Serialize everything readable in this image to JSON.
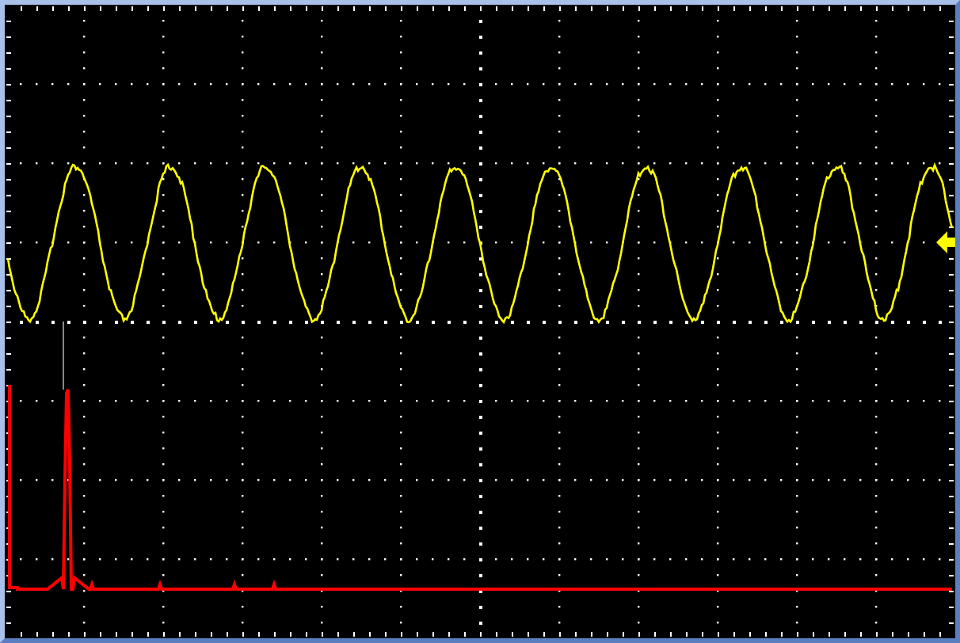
{
  "screen": {
    "traces": [
      {
        "kind": "waveform",
        "color": "#ffff00"
      },
      {
        "kind": "spectrum",
        "color": "#ff0000"
      }
    ],
    "level_marker": {
      "color": "#ffff00"
    }
  }
}
